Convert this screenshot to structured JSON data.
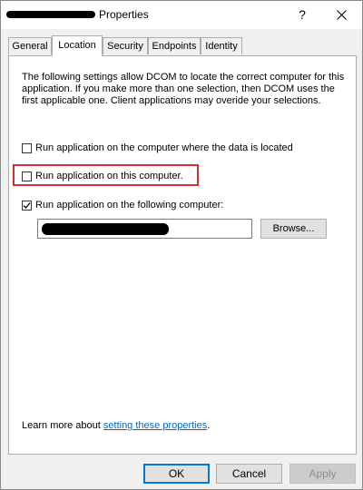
{
  "window": {
    "title_suffix": "Properties",
    "help_label": "?"
  },
  "tabs": [
    {
      "label": "General"
    },
    {
      "label": "Location"
    },
    {
      "label": "Security"
    },
    {
      "label": "Endpoints"
    },
    {
      "label": "Identity"
    }
  ],
  "active_tab": "Location",
  "location": {
    "description": "The following settings allow DCOM to locate the correct computer for this application. If you make more than one selection, then DCOM uses the first applicable one. Client applications may overide your selections.",
    "options": [
      {
        "label": "Run application on the computer where the data is located",
        "checked": false
      },
      {
        "label": "Run application on this computer.",
        "checked": false
      },
      {
        "label": "Run application on the following computer:",
        "checked": true
      }
    ],
    "computer_value": "",
    "browse_label": "Browse...",
    "learn_prefix": "Learn more about ",
    "learn_link": "setting these properties",
    "learn_suffix": "."
  },
  "buttons": {
    "ok": "OK",
    "cancel": "Cancel",
    "apply": "Apply"
  },
  "colors": {
    "highlight_border": "#d32f2f",
    "link": "#0066cc",
    "default_button_border": "#0078d7"
  }
}
